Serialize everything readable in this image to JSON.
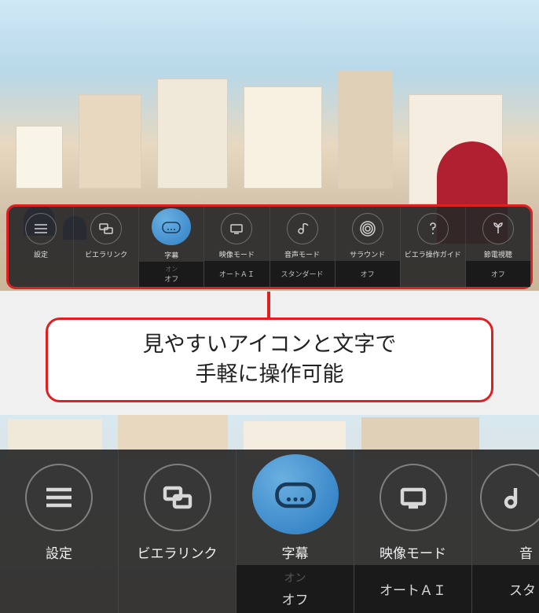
{
  "callout": {
    "line1": "見やすいアイコンと文字で",
    "line2": "手軽に操作可能"
  },
  "top_menu": {
    "items": [
      {
        "label": "設定",
        "value_dim": "",
        "value": "",
        "icon": "settings-icon"
      },
      {
        "label": "ビエラリンク",
        "value_dim": "",
        "value": "",
        "icon": "viera-link-icon"
      },
      {
        "label": "字幕",
        "value_dim": "オン",
        "value": "オフ",
        "icon": "subtitle-icon",
        "active": true
      },
      {
        "label": "映像モード",
        "value_dim": "",
        "value": "オートＡＩ",
        "icon": "picture-mode-icon"
      },
      {
        "label": "音声モード",
        "value_dim": "",
        "value": "スタンダード",
        "icon": "sound-mode-icon"
      },
      {
        "label": "サラウンド",
        "value_dim": "",
        "value": "オフ",
        "icon": "surround-icon"
      },
      {
        "label": "ビエラ操作ガイド",
        "value_dim": "",
        "value": "",
        "icon": "help-icon"
      },
      {
        "label": "節電視聴",
        "value_dim": "",
        "value": "オフ",
        "icon": "eco-icon"
      }
    ]
  },
  "bottom_menu": {
    "items": [
      {
        "label": "設定",
        "value_dim": "",
        "value": "",
        "icon": "settings-icon"
      },
      {
        "label": "ビエラリンク",
        "value_dim": "",
        "value": "",
        "icon": "viera-link-icon"
      },
      {
        "label": "字幕",
        "value_dim": "オン",
        "value": "オフ",
        "icon": "subtitle-icon",
        "active": true
      },
      {
        "label": "映像モード",
        "value_dim": "",
        "value": "オートＡＩ",
        "icon": "picture-mode-icon"
      },
      {
        "label": "音",
        "value_dim": "",
        "value": "スタ",
        "icon": "sound-mode-icon"
      }
    ]
  }
}
